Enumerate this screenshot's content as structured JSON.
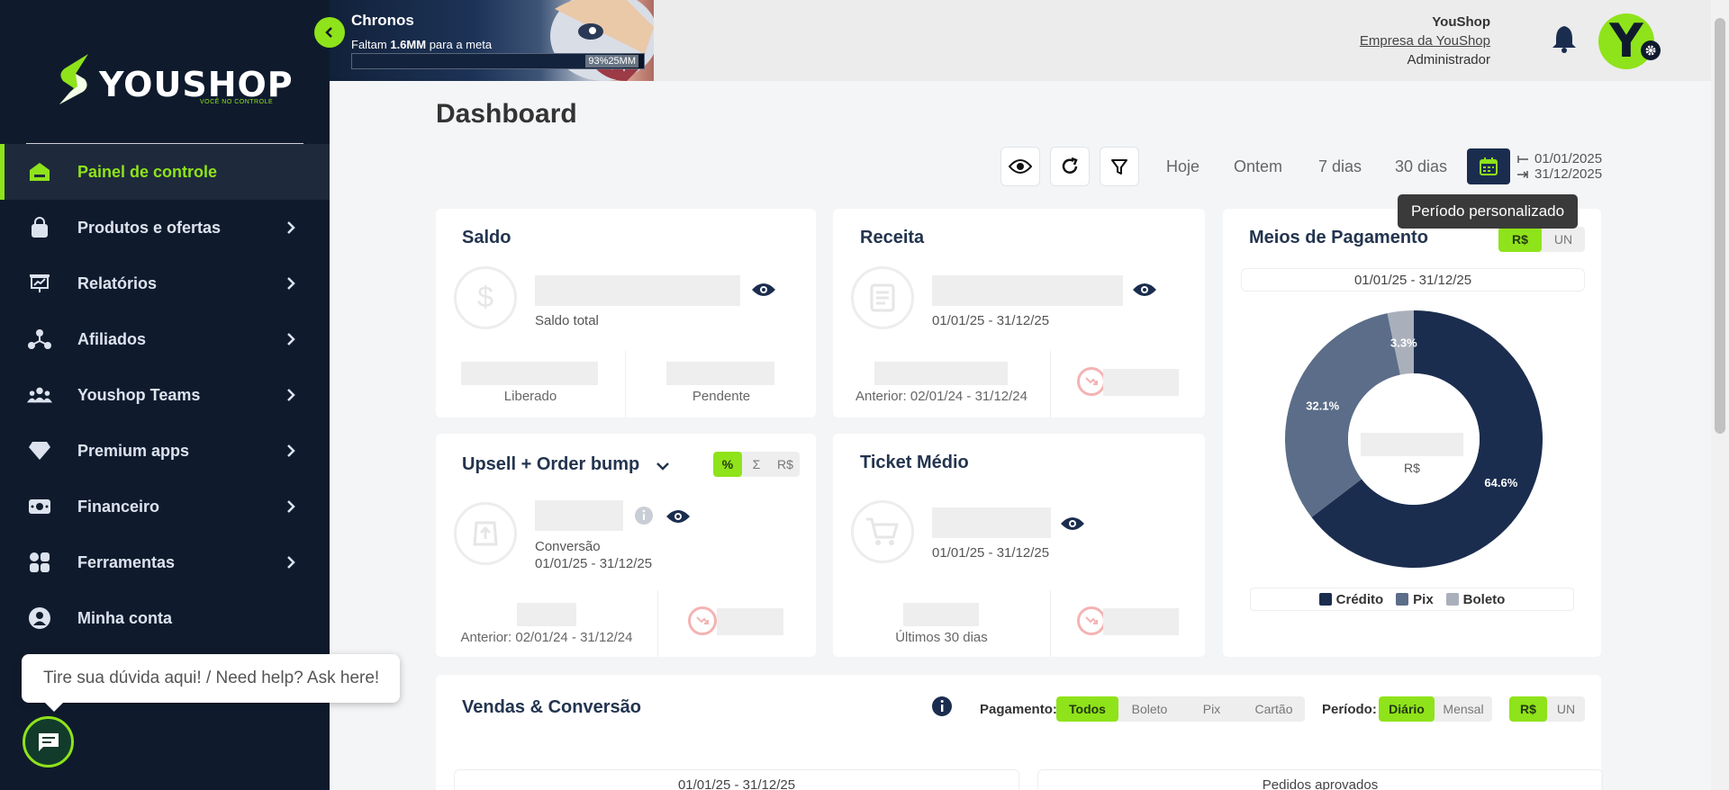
{
  "sidebar": {
    "logo_text": "YOUSHOP",
    "logo_tagline": "VOCÊ NO CONTROLE",
    "items": [
      {
        "label": "Painel de controle",
        "icon": "home-icon"
      },
      {
        "label": "Produtos e ofertas",
        "icon": "bag-icon"
      },
      {
        "label": "Relatórios",
        "icon": "report-icon"
      },
      {
        "label": "Afiliados",
        "icon": "affiliates-icon"
      },
      {
        "label": "Youshop Teams",
        "icon": "team-icon"
      },
      {
        "label": "Premium apps",
        "icon": "diamond-icon"
      },
      {
        "label": "Financeiro",
        "icon": "money-icon"
      },
      {
        "label": "Ferramentas",
        "icon": "tools-icon"
      },
      {
        "label": "Minha conta",
        "icon": "account-icon"
      }
    ],
    "help_text": "Tire sua dúvida aqui! / Need help? Ask here!"
  },
  "goal": {
    "title": "Chronos",
    "prefix": "Faltam ",
    "amount": "1.6MM",
    "suffix": " para a meta",
    "progress_label": "93%25MM",
    "progress": 0.93
  },
  "user": {
    "name": "YouShop",
    "company": "Empresa da YouShop",
    "role": "Administrador",
    "avatar_letter": "Y"
  },
  "dashboard": {
    "title": "Dashboard",
    "periods": [
      "Hoje",
      "Ontem",
      "7 dias",
      "30 dias"
    ],
    "date_start": "01/01/2025",
    "date_end": "31/12/2025",
    "tooltip": "Período personalizado"
  },
  "saldo": {
    "title": "Saldo",
    "total_label": "Saldo total",
    "released_label": "Liberado",
    "pending_label": "Pendente"
  },
  "receita": {
    "title": "Receita",
    "range": "01/01/25 - 31/12/25",
    "previous": "Anterior: 02/01/24 - 31/12/24"
  },
  "upsell": {
    "title": "Upsell + Order bump",
    "modes": [
      "%",
      "Σ",
      "R$"
    ],
    "conversion_label": "Conversão",
    "range": "01/01/25 - 31/12/25",
    "previous": "Anterior: 02/01/24 - 31/12/24"
  },
  "ticket": {
    "title": "Ticket Médio",
    "range": "01/01/25 - 31/12/25",
    "last_days": "Últimos 30 dias"
  },
  "payments": {
    "title": "Meios de Pagamento",
    "units": [
      "R$",
      "UN"
    ],
    "range": "01/01/25 - 31/12/25",
    "center_label": "R$"
  },
  "chart_data": {
    "type": "pie",
    "categories": [
      "Crédito",
      "Pix",
      "Boleto"
    ],
    "values": [
      64.6,
      32.1,
      3.3
    ],
    "labels": [
      "64.6%",
      "32.1%",
      "3.3%"
    ],
    "colors": [
      "#1b2d4f",
      "#5b6d88",
      "#a9b0bb"
    ],
    "legend": "bottom"
  },
  "sales": {
    "title": "Vendas & Conversão",
    "payment_label": "Pagamento:",
    "payment_options": [
      "Todos",
      "Boleto",
      "Pix",
      "Cartão"
    ],
    "period_label": "Período:",
    "period_options": [
      "Diário",
      "Mensal"
    ],
    "units": [
      "R$",
      "UN"
    ],
    "range": "01/01/25 - 31/12/25",
    "approved": "Pedidos aprovados"
  }
}
